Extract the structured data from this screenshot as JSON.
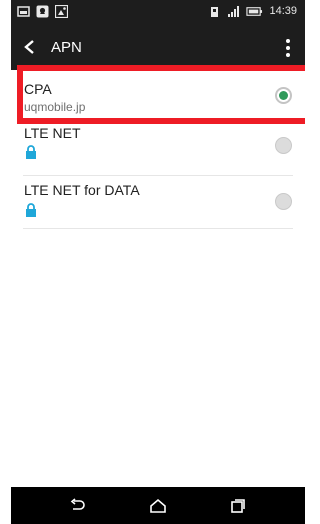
{
  "status_bar": {
    "time": "14:39",
    "left_icons": [
      "image-icon",
      "navigation-app-icon",
      "photo-app-icon"
    ],
    "right_icons": [
      "sim-signal-icon",
      "cellular-signal-icon",
      "battery-icon"
    ]
  },
  "toolbar": {
    "title": "APN",
    "back_icon": "chevron-left-icon",
    "menu_icon": "more-vert-icon"
  },
  "apn_list": [
    {
      "name": "CPA",
      "apn": "uqmobile.jp",
      "selected": true,
      "locked": false,
      "highlighted": true
    },
    {
      "name": "LTE NET",
      "apn": "",
      "selected": false,
      "locked": true
    },
    {
      "name": "LTE NET for DATA",
      "apn": "",
      "selected": false,
      "locked": true
    }
  ],
  "nav_bar": {
    "buttons": [
      "back-icon",
      "home-icon",
      "recents-icon"
    ]
  },
  "colors": {
    "bar": "#1d1d1d",
    "accent_radio": "#2f9a5a",
    "lock": "#1fa7d9",
    "highlight": "#ee1c25"
  }
}
